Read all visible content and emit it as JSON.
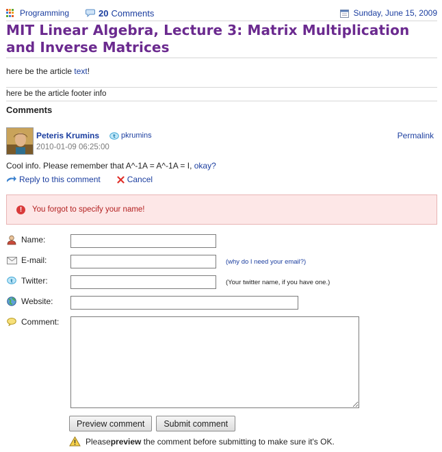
{
  "meta": {
    "category": "Programming",
    "comments_count": "20",
    "comments_label": "Comments",
    "date": "Sunday, June 15, 2009"
  },
  "post": {
    "title": "MIT Linear Algebra, Lecture 3: Matrix Multiplication and Inverse Matrices",
    "article_text_before": "here be the article ",
    "article_link": "text",
    "article_text_after": "!",
    "footer_info": "here be the article footer info"
  },
  "comments_heading": "Comments",
  "comment": {
    "author": "Peteris Krumins",
    "twitter": "pkrumins",
    "timestamp": "2010-01-09 06:25:00",
    "permalink": "Permalink",
    "body_text": "Cool info. Please remember that A^-1A = A^-1A = I, ",
    "body_link": "okay?",
    "reply_label": "Reply to this comment",
    "cancel_label": "Cancel"
  },
  "error": {
    "message": "You forgot to specify your name!"
  },
  "form": {
    "name_label": "Name:",
    "name_value": "",
    "email_label": "E-mail:",
    "email_value": "",
    "email_hint": "(why do I need your email?)",
    "twitter_label": "Twitter:",
    "twitter_value": "",
    "twitter_hint": "(Your twitter name, if you have one.)",
    "website_label": "Website:",
    "website_value": "",
    "comment_label": "Comment:",
    "comment_value": "",
    "preview_button": "Preview comment",
    "submit_button": "Submit comment",
    "notice_before": "Please ",
    "notice_bold": "preview",
    "notice_after": " the comment before submitting to make sure it's OK."
  },
  "colors": {
    "title": "#6b2a8f",
    "link": "#1a3d9f",
    "error_bg": "#fde7e7",
    "error_text": "#b32020"
  }
}
